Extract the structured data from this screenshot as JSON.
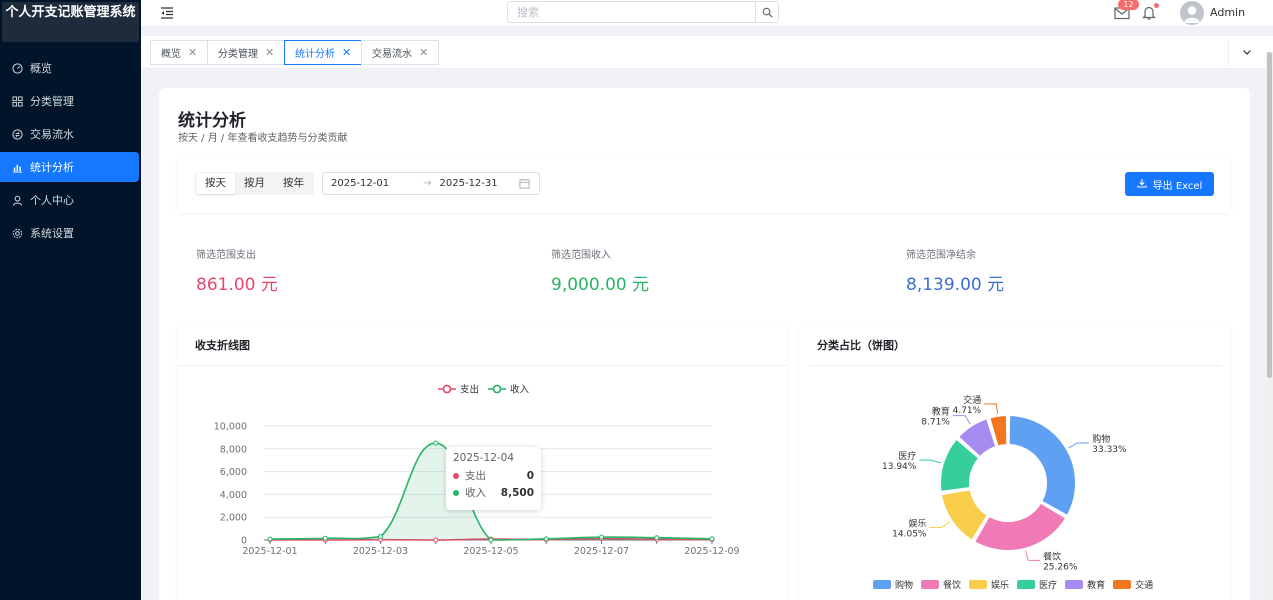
{
  "app": {
    "title": "个人开支记账管理系统"
  },
  "colors": {
    "accent": "#1677ff",
    "expense": "#e8476b",
    "income": "#27b466",
    "net": "#3c6ccf"
  },
  "sidebar": {
    "items": [
      {
        "label": "概览",
        "icon": "dashboard-icon"
      },
      {
        "label": "分类管理",
        "icon": "grid-icon"
      },
      {
        "label": "交易流水",
        "icon": "transaction-icon"
      },
      {
        "label": "统计分析",
        "icon": "bar-chart-icon",
        "active": true
      },
      {
        "label": "个人中心",
        "icon": "user-icon"
      },
      {
        "label": "系统设置",
        "icon": "gear-icon"
      }
    ]
  },
  "topbar": {
    "search_placeholder": "搜索",
    "mail_badge": "12",
    "username": "Admin"
  },
  "tabs": [
    {
      "label": "概览"
    },
    {
      "label": "分类管理"
    },
    {
      "label": "统计分析",
      "active": true
    },
    {
      "label": "交易流水"
    }
  ],
  "page": {
    "title": "统计分析",
    "subtitle": "按天 / 月 / 年查看收支趋势与分类贡献"
  },
  "filter": {
    "granularity": [
      "按天",
      "按月",
      "按年"
    ],
    "selected": "按天",
    "start_date": "2025-12-01",
    "end_date": "2025-12-31",
    "export_label": "导出 Excel"
  },
  "stats": {
    "expense": {
      "label": "筛选范围支出",
      "value": "861.00 元"
    },
    "income": {
      "label": "筛选范围收入",
      "value": "9,000.00 元"
    },
    "net": {
      "label": "筛选范围净结余",
      "value": "8,139.00 元"
    }
  },
  "line_card_title": "收支折线图",
  "pie_card_title": "分类占比（饼图）",
  "tooltip": {
    "date": "2025-12-04",
    "rows": [
      {
        "name": "支出",
        "value": "0"
      },
      {
        "name": "收入",
        "value": "8,500"
      }
    ]
  },
  "chart_data": [
    {
      "type": "line",
      "x": [
        "2025-12-01",
        "2025-12-02",
        "2025-12-03",
        "2025-12-04",
        "2025-12-05",
        "2025-12-06",
        "2025-12-07",
        "2025-12-08",
        "2025-12-09"
      ],
      "x_tick_labels": [
        "2025-12-01",
        "2025-12-03",
        "2025-12-05",
        "2025-12-07",
        "2025-12-09"
      ],
      "series": [
        {
          "name": "支出",
          "color": "#e8476b",
          "values": [
            20,
            0,
            30,
            0,
            80,
            40,
            120,
            60,
            40
          ]
        },
        {
          "name": "收入",
          "color": "#27b466",
          "values": [
            80,
            150,
            300,
            8500,
            0,
            100,
            250,
            200,
            100
          ]
        }
      ],
      "y_ticks": [
        "0",
        "2,000",
        "4,000",
        "6,000",
        "8,000",
        "10,000"
      ],
      "ylim": [
        0,
        10000
      ],
      "grid": true,
      "legend": "top-center"
    },
    {
      "type": "pie",
      "categories": [
        "购物",
        "餐饮",
        "娱乐",
        "医疗",
        "教育",
        "交通"
      ],
      "values": [
        33.33,
        25.26,
        14.05,
        13.94,
        8.71,
        4.71
      ],
      "labels": [
        "33.33%",
        "25.26%",
        "14.05%",
        "13.94%",
        "8.71%",
        "4.71%"
      ],
      "colors": [
        "#5fa0f3",
        "#ef7ab6",
        "#f8cd4a",
        "#36cf9b",
        "#a78bf0",
        "#f2761f"
      ],
      "donut": true,
      "legend": "bottom"
    }
  ]
}
